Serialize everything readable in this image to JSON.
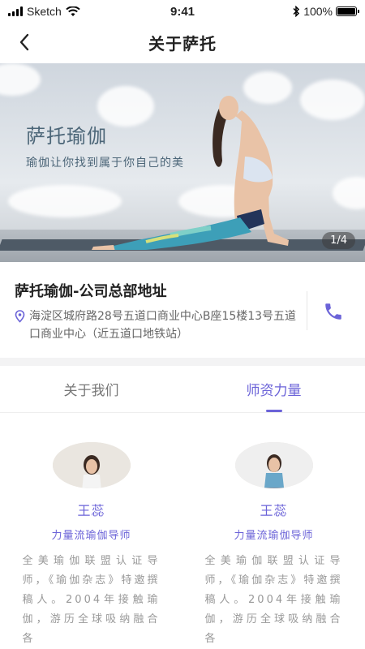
{
  "status_bar": {
    "carrier": "Sketch",
    "time": "9:41",
    "battery": "100%",
    "battery_level": 1.0
  },
  "nav": {
    "title": "关于萨托"
  },
  "banner": {
    "title": "萨托瑜伽",
    "subtitle": "瑜伽让你找到属于你自己的美",
    "page_indicator": "1/4"
  },
  "address": {
    "title": "萨托瑜伽-公司总部地址",
    "text": "海淀区城府路28号五道口商业中心B座15楼13号五道口商业中心（近五道口地铁站）"
  },
  "tabs": [
    {
      "label": "关于我们",
      "active": false
    },
    {
      "label": "师资力量",
      "active": true
    }
  ],
  "teachers": [
    {
      "name": "王蕊",
      "title": "力量流瑜伽导师",
      "bio": "全美瑜伽联盟认证导师，《瑜伽杂志》特邀撰稿人。2004年接触瑜伽，游历全球吸纳融合各"
    },
    {
      "name": "王蕊",
      "title": "力量流瑜伽导师",
      "bio": "全美瑜伽联盟认证导师，《瑜伽杂志》特邀撰稿人。2004年接触瑜伽，游历全球吸纳融合各"
    }
  ],
  "colors": {
    "accent": "#6b63d8",
    "text_primary": "#222222",
    "text_secondary": "#666666",
    "text_muted": "#999999"
  }
}
